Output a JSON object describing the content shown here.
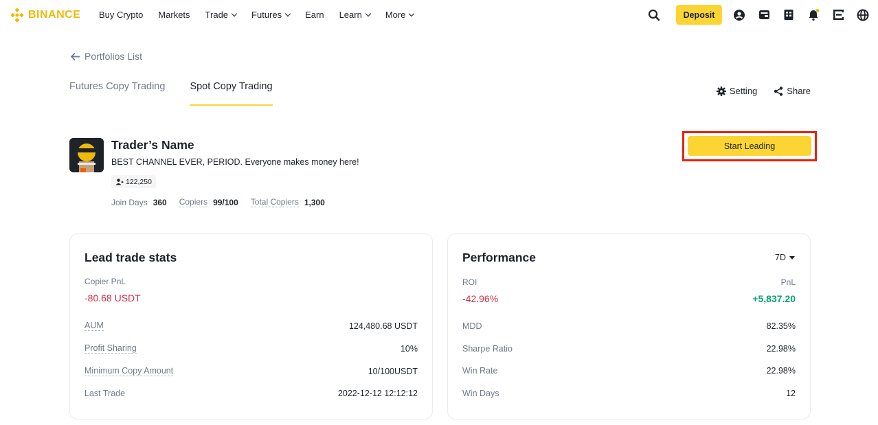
{
  "header": {
    "logo_text": "BINANCE",
    "nav": [
      {
        "label": "Buy Crypto",
        "dropdown": false
      },
      {
        "label": "Markets",
        "dropdown": false
      },
      {
        "label": "Trade",
        "dropdown": true
      },
      {
        "label": "Futures",
        "dropdown": true
      },
      {
        "label": "Earn",
        "dropdown": false
      },
      {
        "label": "Learn",
        "dropdown": true
      },
      {
        "label": "More",
        "dropdown": true
      }
    ],
    "deposit_label": "Deposit",
    "icons": [
      "search-icon",
      "user-icon",
      "wallet-icon",
      "orders-icon",
      "bell-icon",
      "download-icon",
      "globe-icon"
    ]
  },
  "back_label": "Portfolios List",
  "tabs": [
    {
      "label": "Futures Copy Trading",
      "active": false
    },
    {
      "label": "Spot Copy Trading",
      "active": true
    }
  ],
  "actions": {
    "setting_label": "Setting",
    "share_label": "Share"
  },
  "trader": {
    "name": "Trader’s Name",
    "bio": "BEST CHANNEL EVER, PERIOD. Everyone makes money here!",
    "followers": "122,250",
    "join_days_label": "Join Days",
    "join_days": "360",
    "copiers_label": "Copiers",
    "copiers": "99/100",
    "total_copiers_label": "Total Copiers",
    "total_copiers": "1,300"
  },
  "start_leading_label": "Start Leading",
  "lead_stats": {
    "title": "Lead trade stats",
    "copier_pnl_label": "Copier PnL",
    "copier_pnl": "-80.68 USDT",
    "rows": [
      {
        "label": "AUM",
        "value": "124,480.68 USDT"
      },
      {
        "label": "Profit Sharing",
        "value": "10%"
      },
      {
        "label": "Minimum Copy Amount",
        "value": "10/100USDT"
      },
      {
        "label": "Last Trade",
        "value": "2022-12-12 12:12:12"
      }
    ]
  },
  "performance": {
    "title": "Performance",
    "period": "7D",
    "roi_label": "ROI",
    "roi": "-42.96%",
    "pnl_label": "PnL",
    "pnl": "+5,837.20",
    "rows": [
      {
        "label": "MDD",
        "value": "82.35%"
      },
      {
        "label": "Sharpe Ratio",
        "value": "22.98%"
      },
      {
        "label": "Win Rate",
        "value": "22.98%"
      },
      {
        "label": "Win Days",
        "value": "12"
      }
    ]
  },
  "colors": {
    "brand": "#F0B90B",
    "button_yellow": "#FCD535",
    "negative": "#CF304A",
    "positive": "#03A66D",
    "highlight_box": "#E8220C"
  }
}
